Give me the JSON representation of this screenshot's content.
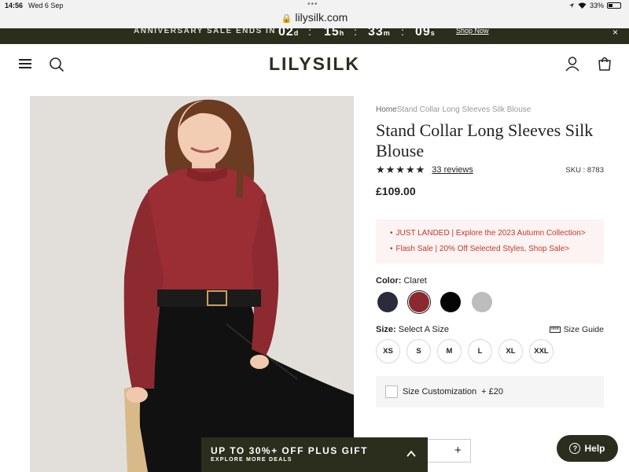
{
  "status_bar": {
    "time": "14:56",
    "date": "Wed 6 Sep",
    "battery": "33%",
    "url": "lilysilk.com"
  },
  "sale_banner": {
    "text": "ANNIVERSARY SALE ENDS IN",
    "days": "02",
    "days_unit": "d",
    "hours": "15",
    "hours_unit": "h",
    "minutes": "33",
    "minutes_unit": "m",
    "seconds": "09",
    "seconds_unit": "s",
    "link": "Shop Now",
    "close": "×"
  },
  "header": {
    "logo": "LILYSILK"
  },
  "product": {
    "breadcrumb_home": "Home",
    "breadcrumb_current": "Stand Collar Long Sleeves Silk Blouse",
    "title": "Stand Collar Long Sleeves Silk Blouse",
    "stars": "★★★★★",
    "reviews": "33 reviews",
    "sku": "SKU : 8783",
    "price": "£109.00",
    "promos": [
      "JUST LANDED | Explore the 2023 Autumn Collection>",
      "Flash Sale | 20% Off Selected Styles, Shop Sale>"
    ],
    "color_label": "Color:",
    "color_value": "Claret",
    "swatches": [
      {
        "name": "navy",
        "color": "#2a2c3c"
      },
      {
        "name": "claret",
        "color": "#8a2a2e"
      },
      {
        "name": "black",
        "color": "#050505"
      },
      {
        "name": "grey",
        "color": "#bdbdc0"
      }
    ],
    "size_label": "Size:",
    "size_value": "Select A Size",
    "size_guide": "Size Guide",
    "sizes": [
      "XS",
      "S",
      "M",
      "L",
      "XL",
      "XXL"
    ],
    "customization_label": "Size Customization",
    "customization_price": "+ £20",
    "qty_plus": "+"
  },
  "offer_bar": {
    "title": "UP TO 30%+ OFF PLUS GIFT",
    "subtitle": "EXPLORE MORE DEALS"
  },
  "help": {
    "label": "Help",
    "icon": "?"
  },
  "colors": {
    "brand_dark": "#2b2d1d",
    "promo_red": "#c0392b"
  }
}
